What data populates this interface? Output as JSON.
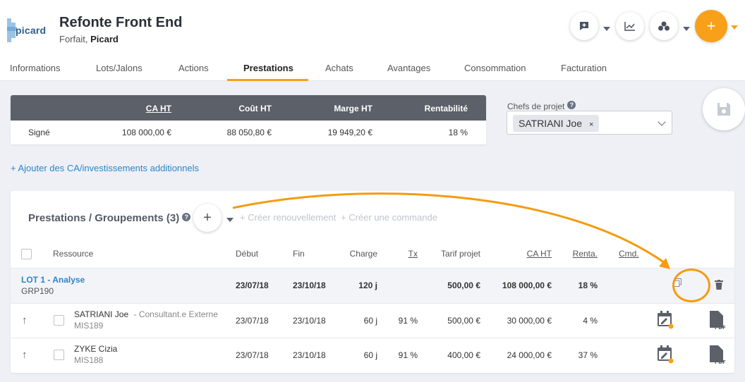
{
  "header": {
    "logo_text": "Picard",
    "title": "Refonte Front End",
    "subtitle_type": "Forfait,",
    "subtitle_client": "Picard",
    "plus_label": "+"
  },
  "tabs": [
    {
      "label": "Informations"
    },
    {
      "label": "Lots/Jalons"
    },
    {
      "label": "Actions"
    },
    {
      "label": "Prestations",
      "active": true
    },
    {
      "label": "Achats"
    },
    {
      "label": "Avantages"
    },
    {
      "label": "Consommation"
    },
    {
      "label": "Facturation"
    }
  ],
  "summary": {
    "headers": [
      "CA HT",
      "Coût HT",
      "Marge HT",
      "Rentabilité"
    ],
    "row_label": "Signé",
    "values": [
      "108 000,00 €",
      "88 050,80 €",
      "19 949,20 €",
      "18 %"
    ]
  },
  "chefs": {
    "label": "Chefs de projet",
    "help": "?",
    "selected": "SATRIANI Joe",
    "remove": "×"
  },
  "add_link": "+ Ajouter des CA/investissements additionnels",
  "prestations": {
    "title": "Prestations / Groupements (3)",
    "help": "?",
    "plus": "+",
    "renew_link": "+ Créer renouvellement",
    "order_link": "+ Créer une commande",
    "columns": [
      "Ressource",
      "Début",
      "Fin",
      "Charge",
      "Tx",
      "Tarif projet",
      "CA HT",
      "Renta.",
      "Cmd."
    ],
    "lot": {
      "name": "LOT 1 - Analyse",
      "code": "GRP190",
      "debut": "23/07/18",
      "fin": "23/10/18",
      "charge": "120 j",
      "tarif": "500,00 €",
      "ca": "108 000,00 €",
      "renta": "18 %"
    },
    "rows": [
      {
        "name": "SATRIANI Joe",
        "role": "- Consultant.e Externe",
        "code": "MIS189",
        "debut": "23/07/18",
        "fin": "23/10/18",
        "charge": "60 j",
        "tx": "91 %",
        "tarif": "500,00 €",
        "ca": "30 000,00 €",
        "renta": "4 %"
      },
      {
        "name": "ZYKE Cizia",
        "role": "",
        "code": "MIS188",
        "debut": "23/07/18",
        "fin": "23/10/18",
        "charge": "60 j",
        "tx": "91 %",
        "tarif": "400,00 €",
        "ca": "24 000,00 €",
        "renta": "37 %"
      }
    ],
    "pdf_label": "PDF"
  },
  "colors": {
    "accent": "#f8a01a",
    "link": "#2a86c8",
    "dark_header": "#5b6069"
  }
}
